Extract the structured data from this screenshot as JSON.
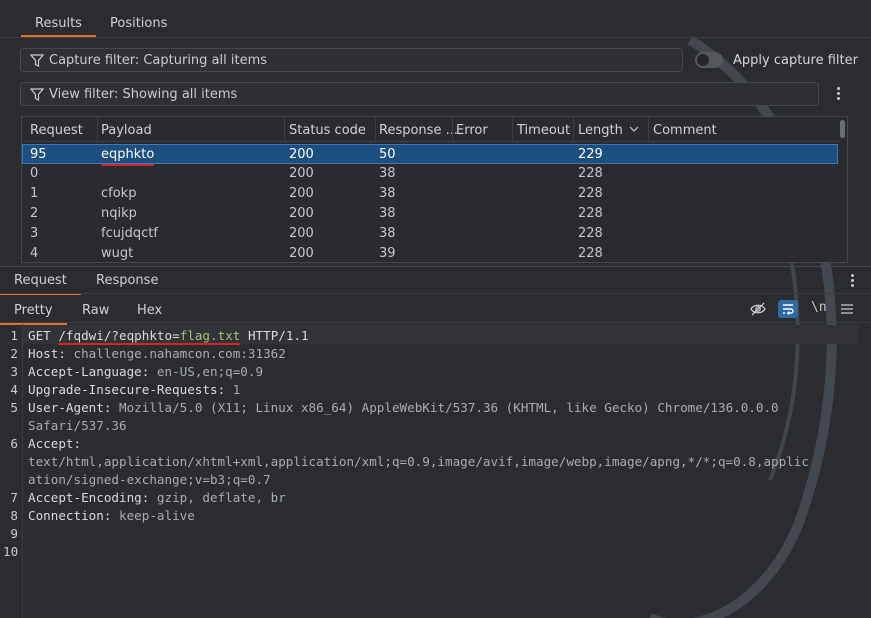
{
  "tabs_top": [
    "Results",
    "Positions"
  ],
  "capture_filter": "Capture filter: Capturing all items",
  "apply_capture_filter": "Apply capture filter",
  "view_filter": "View filter: Showing all items",
  "table": {
    "columns": [
      "Request",
      "Payload",
      "Status code",
      "Response ...",
      "Error",
      "Timeout",
      "Length",
      "Comment"
    ],
    "rows": [
      [
        "95",
        "eqphkto",
        "200",
        "50",
        "",
        "",
        "229",
        ""
      ],
      [
        "0",
        "",
        "200",
        "38",
        "",
        "",
        "228",
        ""
      ],
      [
        "1",
        "cfokp",
        "200",
        "38",
        "",
        "",
        "228",
        ""
      ],
      [
        "2",
        "nqikp",
        "200",
        "38",
        "",
        "",
        "228",
        ""
      ],
      [
        "3",
        "fcujdqctf",
        "200",
        "38",
        "",
        "",
        "228",
        ""
      ],
      [
        "4",
        "wugt",
        "200",
        "39",
        "",
        "",
        "228",
        ""
      ]
    ],
    "selected_row": 0,
    "sort_column": "Length"
  },
  "section_tabs": [
    "Request",
    "Response"
  ],
  "view_tabs": [
    "Pretty",
    "Raw",
    "Hex"
  ],
  "newline_toggle": "\\n",
  "editor": {
    "line_numbers": [
      "1",
      "2",
      "3",
      "4",
      "5",
      "",
      "6",
      "",
      "",
      "7",
      "8",
      "9",
      "10"
    ],
    "request_line": {
      "method": "GET",
      "path": "/fqdwi/?",
      "param": "eqphkto",
      "eq": "=",
      "value": "flag.txt",
      "protocol": "HTTP/1.1"
    },
    "headers": [
      {
        "name": "Host",
        "value": "challenge.nahamcon.com:31362"
      },
      {
        "name": "Accept-Language",
        "value": "en-US,en;q=0.9"
      },
      {
        "name": "Upgrade-Insecure-Requests",
        "value": "1"
      },
      {
        "name": "User-Agent",
        "value": "Mozilla/5.0 (X11; Linux x86_64) AppleWebKit/537.36 (KHTML, like Gecko) Chrome/136.0.0.0"
      },
      {
        "name": "",
        "value": "Safari/537.36"
      },
      {
        "name": "Accept",
        "value": ""
      },
      {
        "name": "",
        "value": "text/html,application/xhtml+xml,application/xml;q=0.9,image/avif,image/webp,image/apng,*/*;q=0.8,applic"
      },
      {
        "name": "",
        "value": "ation/signed-exchange;v=b3;q=0.7"
      },
      {
        "name": "Accept-Encoding",
        "value": "gzip, deflate, br"
      },
      {
        "name": "Connection",
        "value": "keep-alive"
      }
    ]
  },
  "colors": {
    "accent": "#e5702b",
    "selection": "#1d4e80",
    "underline": "#d4242a"
  }
}
